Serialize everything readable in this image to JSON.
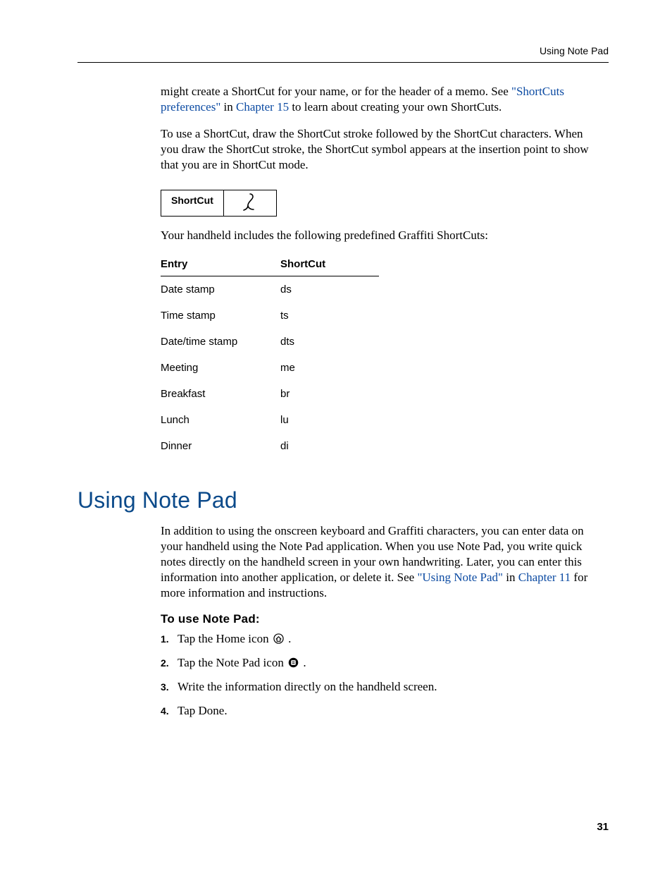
{
  "header": {
    "running_head": "Using Note Pad"
  },
  "intro": {
    "p1_a": "might create a ShortCut for your name, or for the header of a memo. See ",
    "p1_link1": "\"ShortCuts preferences\"",
    "p1_b": " in ",
    "p1_link2": "Chapter 15",
    "p1_c": " to learn about creating your own ShortCuts.",
    "p2": "To use a ShortCut, draw the ShortCut stroke followed by the ShortCut characters. When you draw the ShortCut stroke, the ShortCut symbol appears at the insertion point to show that you are in ShortCut mode.",
    "box_label": "ShortCut",
    "p3": "Your handheld includes the following predefined Graffiti ShortCuts:"
  },
  "table": {
    "head_entry": "Entry",
    "head_shortcut": "ShortCut",
    "rows": [
      {
        "entry": "Date stamp",
        "sc": "ds"
      },
      {
        "entry": "Time stamp",
        "sc": "ts"
      },
      {
        "entry": "Date/time stamp",
        "sc": "dts"
      },
      {
        "entry": "Meeting",
        "sc": "me"
      },
      {
        "entry": "Breakfast",
        "sc": "br"
      },
      {
        "entry": "Lunch",
        "sc": "lu"
      },
      {
        "entry": "Dinner",
        "sc": "di"
      }
    ]
  },
  "section": {
    "title": "Using Note Pad",
    "p1_a": "In addition to using the onscreen keyboard and Graffiti characters, you can enter data on your handheld using the Note Pad application. When you use Note Pad, you write quick notes directly on the handheld screen in your own handwriting. Later, you can enter this information into another application, or delete it. See ",
    "p1_link1": "\"Using Note Pad\"",
    "p1_b": " in ",
    "p1_link2": "Chapter 11",
    "p1_c": " for more information and instructions.",
    "sub": "To use Note Pad:",
    "steps": [
      {
        "n": "1.",
        "a": "Tap the Home icon ",
        "b": " ."
      },
      {
        "n": "2.",
        "a": "Tap the Note Pad icon ",
        "b": " ."
      },
      {
        "n": "3.",
        "a": "Write the information directly on the handheld screen.",
        "b": ""
      },
      {
        "n": "4.",
        "a": "Tap Done.",
        "b": ""
      }
    ]
  },
  "footer": {
    "page": "31"
  }
}
